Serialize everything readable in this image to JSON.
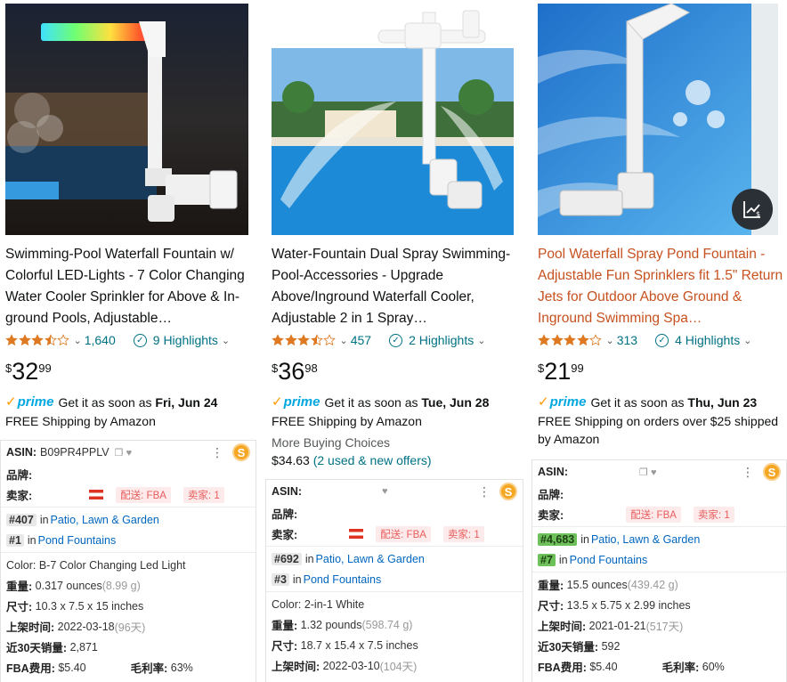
{
  "products": [
    {
      "title": "Swimming-Pool Waterfall Fountain w/ Colorful LED-Lights - 7 Color Changing Water Cooler Sprinkler for Above & In-ground Pools, Adjustable…",
      "rating": 3.5,
      "rating_count": "1,640",
      "highlights": "9 Highlights",
      "price_symbol": "$",
      "price_whole": "32",
      "price_fraction": "99",
      "prime_label": "prime",
      "delivery_prefix": "Get it as soon as",
      "delivery_date": "Fri, Jun 24",
      "shipping": "FREE Shipping by Amazon",
      "panel": {
        "asin_label": "ASIN:",
        "asin_value": "B09PR4PPLV",
        "brand_label": "品牌:",
        "brand_value": "",
        "seller_label": "卖家:",
        "seller_value": "",
        "fulfil_tag": "配送: FBA",
        "seller_count_tag": "卖家: 1",
        "rank1_num": "#407",
        "rank1_in": "in",
        "rank1_cat": "Patio, Lawn & Garden",
        "rank2_num": "#1",
        "rank2_in": "in",
        "rank2_cat": "Pond Fountains",
        "color_text": "Color: B-7 Color Changing Led Light",
        "weight_label": "重量:",
        "weight_value": "0.317 ounces",
        "weight_alt": "(8.99 g)",
        "size_label": "尺寸:",
        "size_value": "10.3 x 7.5 x 15 inches",
        "listed_label": "上架时间:",
        "listed_value": "2022-03-18",
        "listed_days": "(96天)",
        "sales_label": "近30天销量:",
        "sales_value": "2,871",
        "fba_label": "FBA费用:",
        "fba_value": "$5.40",
        "margin_label": "毛利率:",
        "margin_value": "63%"
      }
    },
    {
      "title": "Water-Fountain Dual Spray Swimming-Pool-Accessories - Upgrade Above/Inground Waterfall Cooler, Adjustable 2 in 1 Spray…",
      "rating": 3.5,
      "rating_count": "457",
      "highlights": "2 Highlights",
      "price_symbol": "$",
      "price_whole": "36",
      "price_fraction": "98",
      "prime_label": "prime",
      "delivery_prefix": "Get it as soon as",
      "delivery_date": "Tue, Jun 28",
      "shipping": "FREE Shipping by Amazon",
      "more_buying": "More Buying Choices",
      "more_price": "$34.63",
      "more_offers": "(2 used & new offers)",
      "panel": {
        "asin_label": "ASIN:",
        "asin_value": "",
        "brand_label": "品牌:",
        "brand_value": "",
        "seller_label": "卖家:",
        "seller_value": "",
        "fulfil_tag": "配送: FBA",
        "seller_count_tag": "卖家: 1",
        "rank1_num": "#692",
        "rank1_in": "in",
        "rank1_cat": "Patio, Lawn & Garden",
        "rank2_num": "#3",
        "rank2_in": "in",
        "rank2_cat": "Pond Fountains",
        "color_text": "Color: 2-in-1 White",
        "weight_label": "重量:",
        "weight_value": "1.32 pounds",
        "weight_alt": "(598.74 g)",
        "size_label": "尺寸:",
        "size_value": "18.7 x 15.4 x 7.5 inches",
        "listed_label": "上架时间:",
        "listed_value": "2022-03-10",
        "listed_days": "(104天)"
      }
    },
    {
      "title": "Pool Waterfall Spray Pond Fountain - Adjustable Fun Sprinklers fit 1.5\" Return Jets for Outdoor Above Ground & Inground Swimming Spa…",
      "rating": 4,
      "rating_count": "313",
      "highlights": "4 Highlights",
      "price_symbol": "$",
      "price_whole": "21",
      "price_fraction": "99",
      "prime_label": "prime",
      "delivery_prefix": "Get it as soon as",
      "delivery_date": "Thu, Jun 23",
      "shipping": "FREE Shipping on orders over $25 shipped by Amazon",
      "panel": {
        "asin_label": "ASIN:",
        "asin_value": "",
        "brand_label": "品牌:",
        "brand_value": "",
        "seller_label": "卖家:",
        "seller_value": "",
        "fulfil_tag": "配送: FBA",
        "seller_count_tag": "卖家: 1",
        "rank1_num": "#4,683",
        "rank1_in": "in",
        "rank1_cat": "Patio, Lawn & Garden",
        "rank2_num": "#7",
        "rank2_in": "in",
        "rank2_cat": "Pond Fountains",
        "weight_label": "重量:",
        "weight_value": "15.5 ounces",
        "weight_alt": "(439.42 g)",
        "size_label": "尺寸:",
        "size_value": "13.5 x 5.75 x 2.99 inches",
        "listed_label": "上架时间:",
        "listed_value": "2021-01-21",
        "listed_days": "(517天)",
        "sales_label": "近30天销量:",
        "sales_value": "592",
        "fba_label": "FBA费用:",
        "fba_value": "$5.40",
        "margin_label": "毛利率:",
        "margin_value": "60%"
      }
    }
  ],
  "colors": {
    "star": "#de7921",
    "link": "#007185",
    "title_highlight": "#c7511f",
    "prime": "#00a8e1",
    "green_rank": "#6ec05a"
  },
  "icons": [
    "star-icon",
    "chevron-down-icon",
    "check-circle-icon",
    "prime-check-icon",
    "copy-icon",
    "heart-icon",
    "kebab-menu-icon",
    "sellersprite-logo-icon",
    "trend-chart-icon"
  ]
}
